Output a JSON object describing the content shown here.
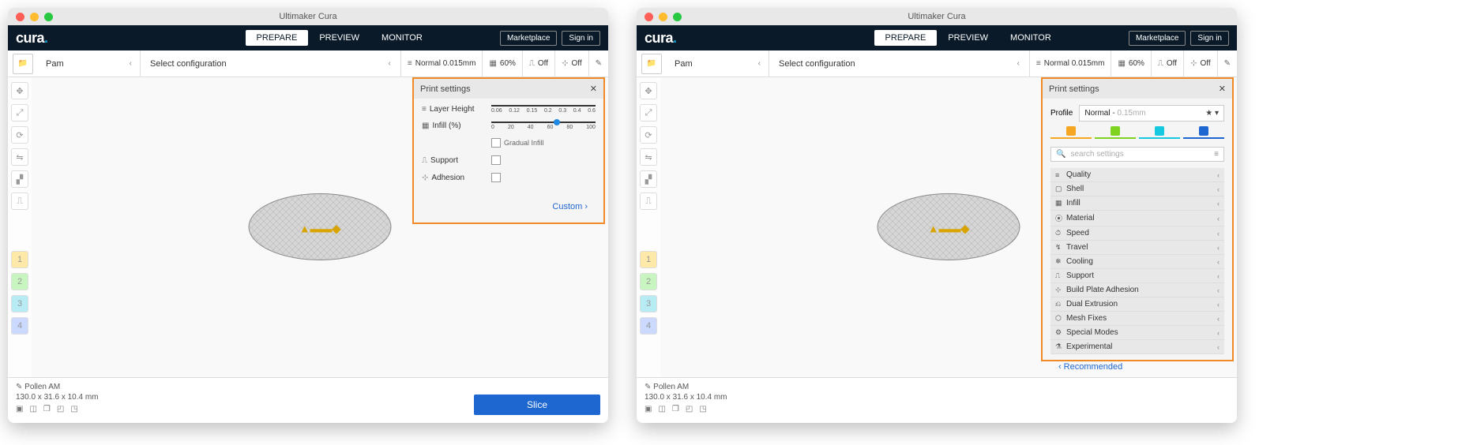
{
  "app_title": "Ultimaker Cura",
  "logo": "cura",
  "tabs": {
    "prepare": "PREPARE",
    "preview": "PREVIEW",
    "monitor": "MONITOR"
  },
  "topbar": {
    "marketplace": "Marketplace",
    "signin": "Sign in"
  },
  "config": {
    "printer": "Pam",
    "select": "Select configuration",
    "profile": "Normal 0.015mm",
    "infill": "60%",
    "support": "Off",
    "adhesion": "Off"
  },
  "panel": {
    "title": "Print settings",
    "layer_height": "Layer Height",
    "layer_ticks": [
      "0.06",
      "0.12",
      "0.15",
      "0.2",
      "0.3",
      "0.4",
      "0.6"
    ],
    "infill_label": "Infill (%)",
    "infill_ticks": [
      "0",
      "20",
      "40",
      "60",
      "80",
      "100"
    ],
    "gradual": "Gradual Infill",
    "support": "Support",
    "adhesion": "Adhesion",
    "custom": "Custom"
  },
  "custom_panel": {
    "profile_label": "Profile",
    "profile_name": "Normal",
    "profile_hint": "0.15mm",
    "search_placeholder": "search settings",
    "categories": [
      "Quality",
      "Shell",
      "Infill",
      "Material",
      "Speed",
      "Travel",
      "Cooling",
      "Support",
      "Build Plate Adhesion",
      "Dual Extrusion",
      "Mesh Fixes",
      "Special Modes",
      "Experimental"
    ],
    "recommended": "Recommended"
  },
  "footer": {
    "name": "Pollen AM",
    "dims": "130.0 x 31.6 x 10.4 mm",
    "slice": "Slice"
  }
}
